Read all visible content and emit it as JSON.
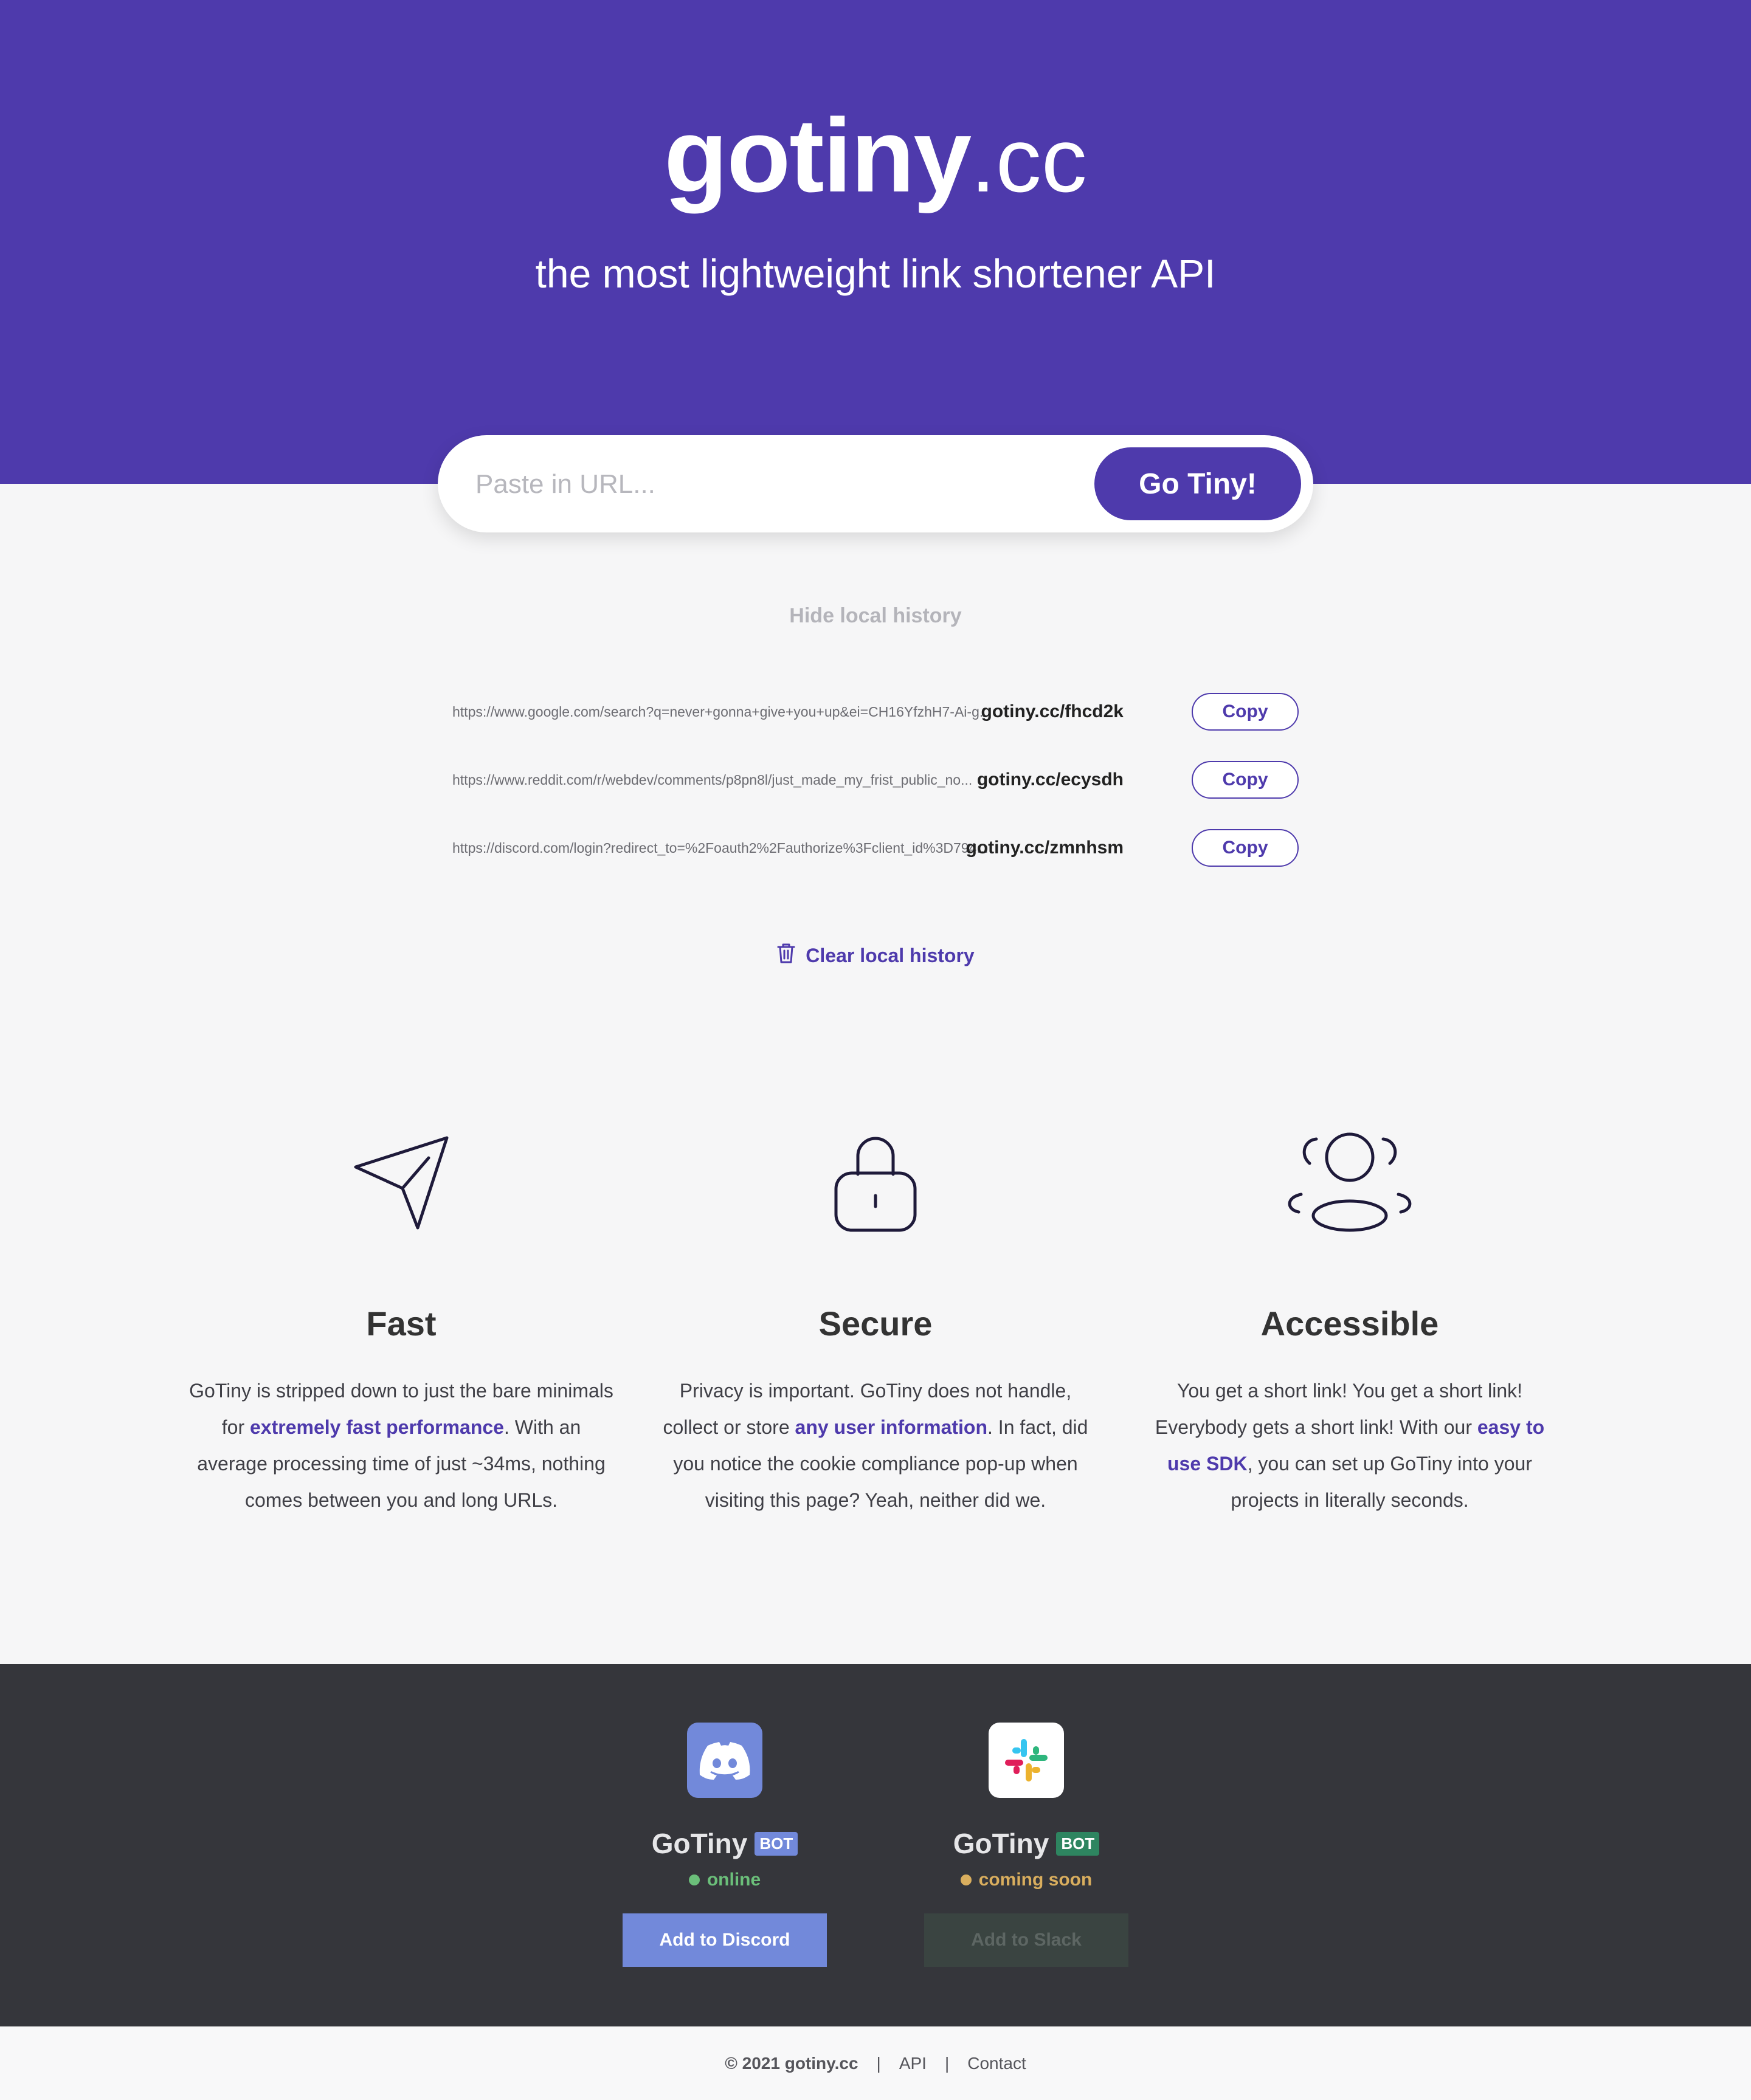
{
  "hero": {
    "logo_bold": "gotiny",
    "logo_light": ".cc",
    "tagline": "the most lightweight link shortener API"
  },
  "search": {
    "placeholder": "Paste in URL...",
    "value": "",
    "button_label": "Go Tiny!"
  },
  "history": {
    "toggle_label": "Hide local history",
    "items": [
      {
        "long": "https://www.google.com/search?q=never+gonna+give+you+up&ei=CH16YfzhH7-Ai-g...",
        "short": "gotiny.cc/fhcd2k",
        "copy": "Copy"
      },
      {
        "long": "https://www.reddit.com/r/webdev/comments/p8pn8l/just_made_my_frist_public_no...",
        "short": "gotiny.cc/ecysdh",
        "copy": "Copy"
      },
      {
        "long": "https://discord.com/login?redirect_to=%2Foauth2%2Fauthorize%3Fclient_id%3D794...",
        "short": "gotiny.cc/zmnhsm",
        "copy": "Copy"
      }
    ],
    "clear_label": "Clear local history"
  },
  "features": [
    {
      "title": "Fast",
      "p1": "GoTiny is stripped down to just the bare minimals for ",
      "link": "extremely fast performance",
      "p2": ". With an average processing time of just ~34ms, nothing comes between you and long URLs."
    },
    {
      "title": "Secure",
      "p1": "Privacy is important. GoTiny does not handle, collect or store ",
      "link": "any user information",
      "p2": ". In fact, did you notice the cookie compliance pop-up when visiting this page? Yeah, neither did we."
    },
    {
      "title": "Accessible",
      "p1": "You get a short link! You get a short link! Everybody gets a short link! With our ",
      "link": "easy to use SDK",
      "p2": ", you can set up GoTiny into your projects in literally seconds."
    }
  ],
  "bots": [
    {
      "name": "GoTiny",
      "badge": "BOT",
      "status": "online",
      "button": "Add to Discord",
      "badge_color": "#7289da",
      "status_color": "#6bbf7a",
      "button_bg": "#7289da",
      "button_color": "#ffffff"
    },
    {
      "name": "GoTiny",
      "badge": "BOT",
      "status": "coming soon",
      "button": "Add to Slack",
      "badge_color": "#2e8560",
      "status_color": "#d9ae5e",
      "button_bg": "#3a4441",
      "button_color": "#5d6663"
    }
  ],
  "footer": {
    "copyright": "© 2021 gotiny.cc",
    "sep1": "|",
    "api": "API",
    "sep2": "|",
    "contact": "Contact"
  },
  "colors": {
    "brand": "#4e3aac",
    "dark_band": "#35363b"
  }
}
